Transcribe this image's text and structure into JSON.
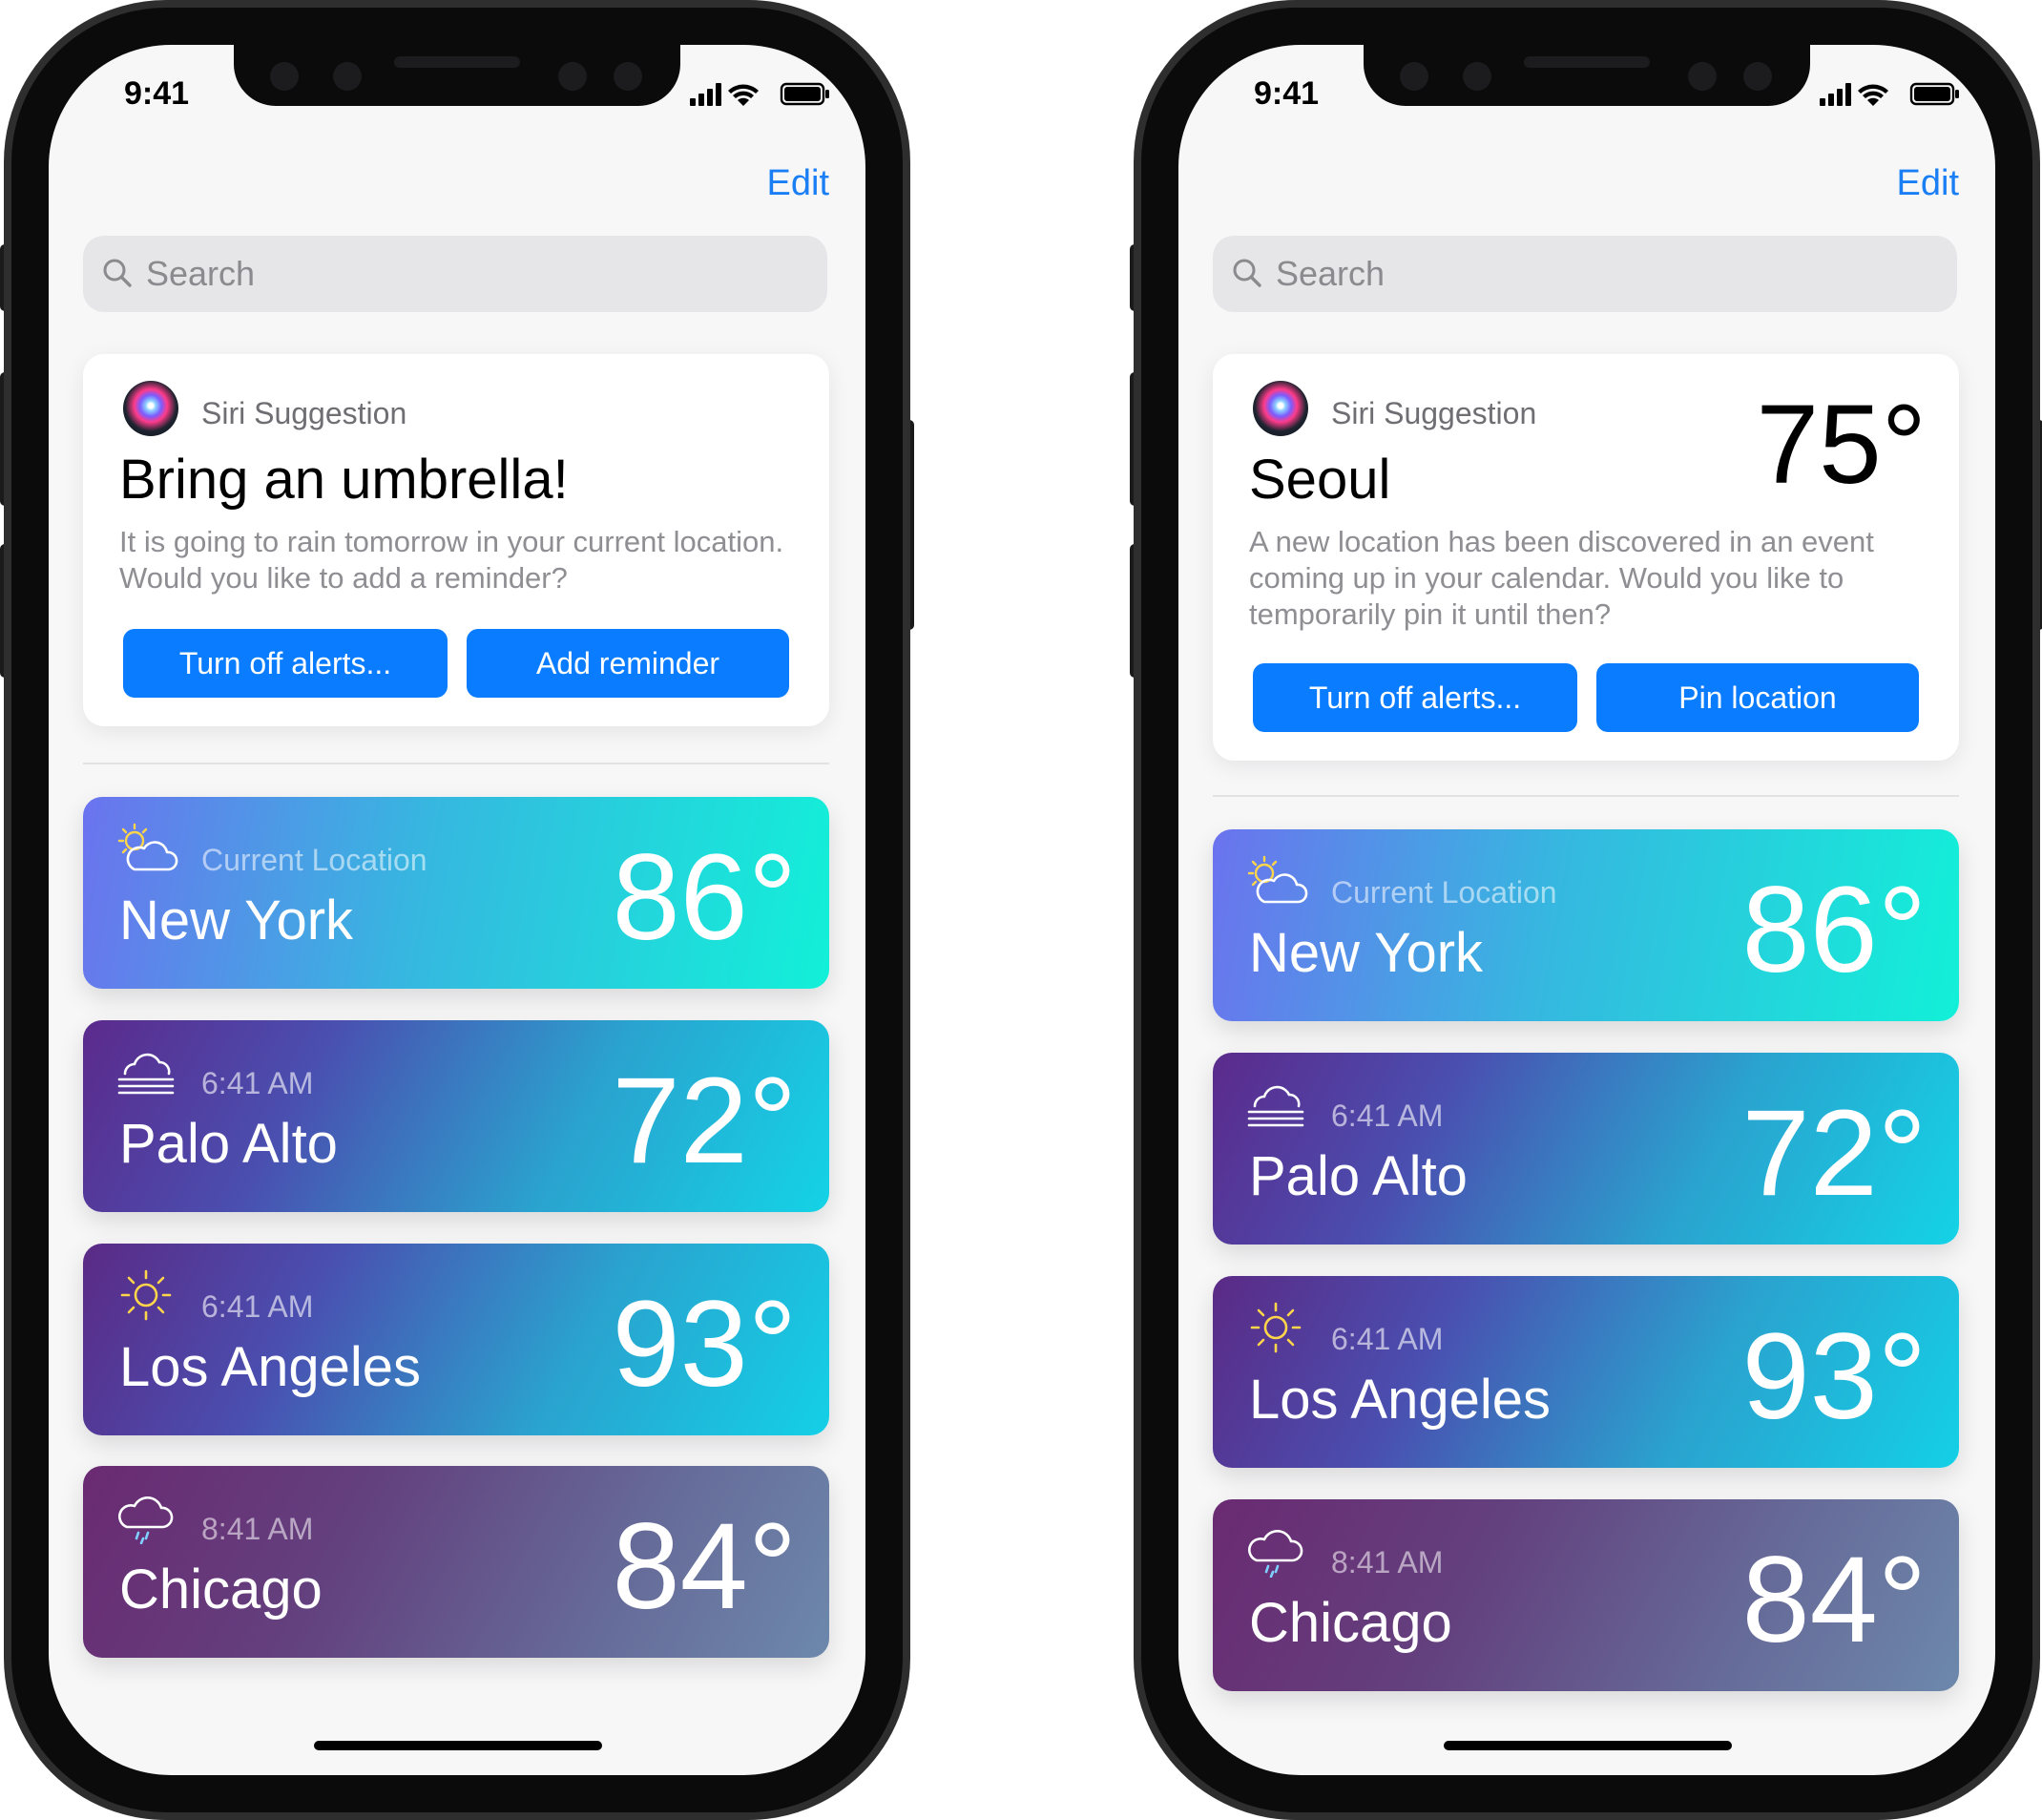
{
  "phones": [
    {
      "status": {
        "time": "9:41"
      },
      "edit_label": "Edit",
      "search": {
        "placeholder": "Search"
      },
      "suggestion": {
        "label": "Siri Suggestion",
        "title": "Bring an umbrella!",
        "temp": "",
        "body": "It is going to rain tomorrow in your current location. Would you like to add a reminder?",
        "buttons": [
          "Turn off alerts...",
          "Add reminder"
        ]
      },
      "weather": [
        {
          "icon": "partly-cloudy-icon",
          "subtitle": "Current Location",
          "city": "New York",
          "temp": "86°"
        },
        {
          "icon": "fog-icon",
          "subtitle": "6:41 AM",
          "city": "Palo Alto",
          "temp": "72°"
        },
        {
          "icon": "sun-icon",
          "subtitle": "6:41 AM",
          "city": "Los Angeles",
          "temp": "93°"
        },
        {
          "icon": "rain-cloud-icon",
          "subtitle": "8:41 AM",
          "city": "Chicago",
          "temp": "84°"
        }
      ]
    },
    {
      "status": {
        "time": "9:41"
      },
      "edit_label": "Edit",
      "search": {
        "placeholder": "Search"
      },
      "suggestion": {
        "label": "Siri Suggestion",
        "title": "Seoul",
        "temp": "75°",
        "body": "A new location has been discovered in an event coming up in your calendar. Would you like to temporarily pin it until then?",
        "buttons": [
          "Turn off alerts...",
          "Pin location"
        ]
      },
      "weather": [
        {
          "icon": "partly-cloudy-icon",
          "subtitle": "Current Location",
          "city": "New York",
          "temp": "86°"
        },
        {
          "icon": "fog-icon",
          "subtitle": "6:41 AM",
          "city": "Palo Alto",
          "temp": "72°"
        },
        {
          "icon": "sun-icon",
          "subtitle": "6:41 AM",
          "city": "Los Angeles",
          "temp": "93°"
        },
        {
          "icon": "rain-cloud-icon",
          "subtitle": "8:41 AM",
          "city": "Chicago",
          "temp": "84°"
        }
      ]
    }
  ],
  "colors": {
    "accent": "#0a7cff",
    "gradient_new_york": [
      "#6b73ee",
      "#12f0d8"
    ],
    "gradient_palo_alto": [
      "#5b2a8c",
      "#14d3e6"
    ],
    "gradient_los_angeles": [
      "#5b2a86",
      "#14d0e6"
    ],
    "gradient_chicago": [
      "#6a2a72",
      "#6d88ac"
    ]
  }
}
